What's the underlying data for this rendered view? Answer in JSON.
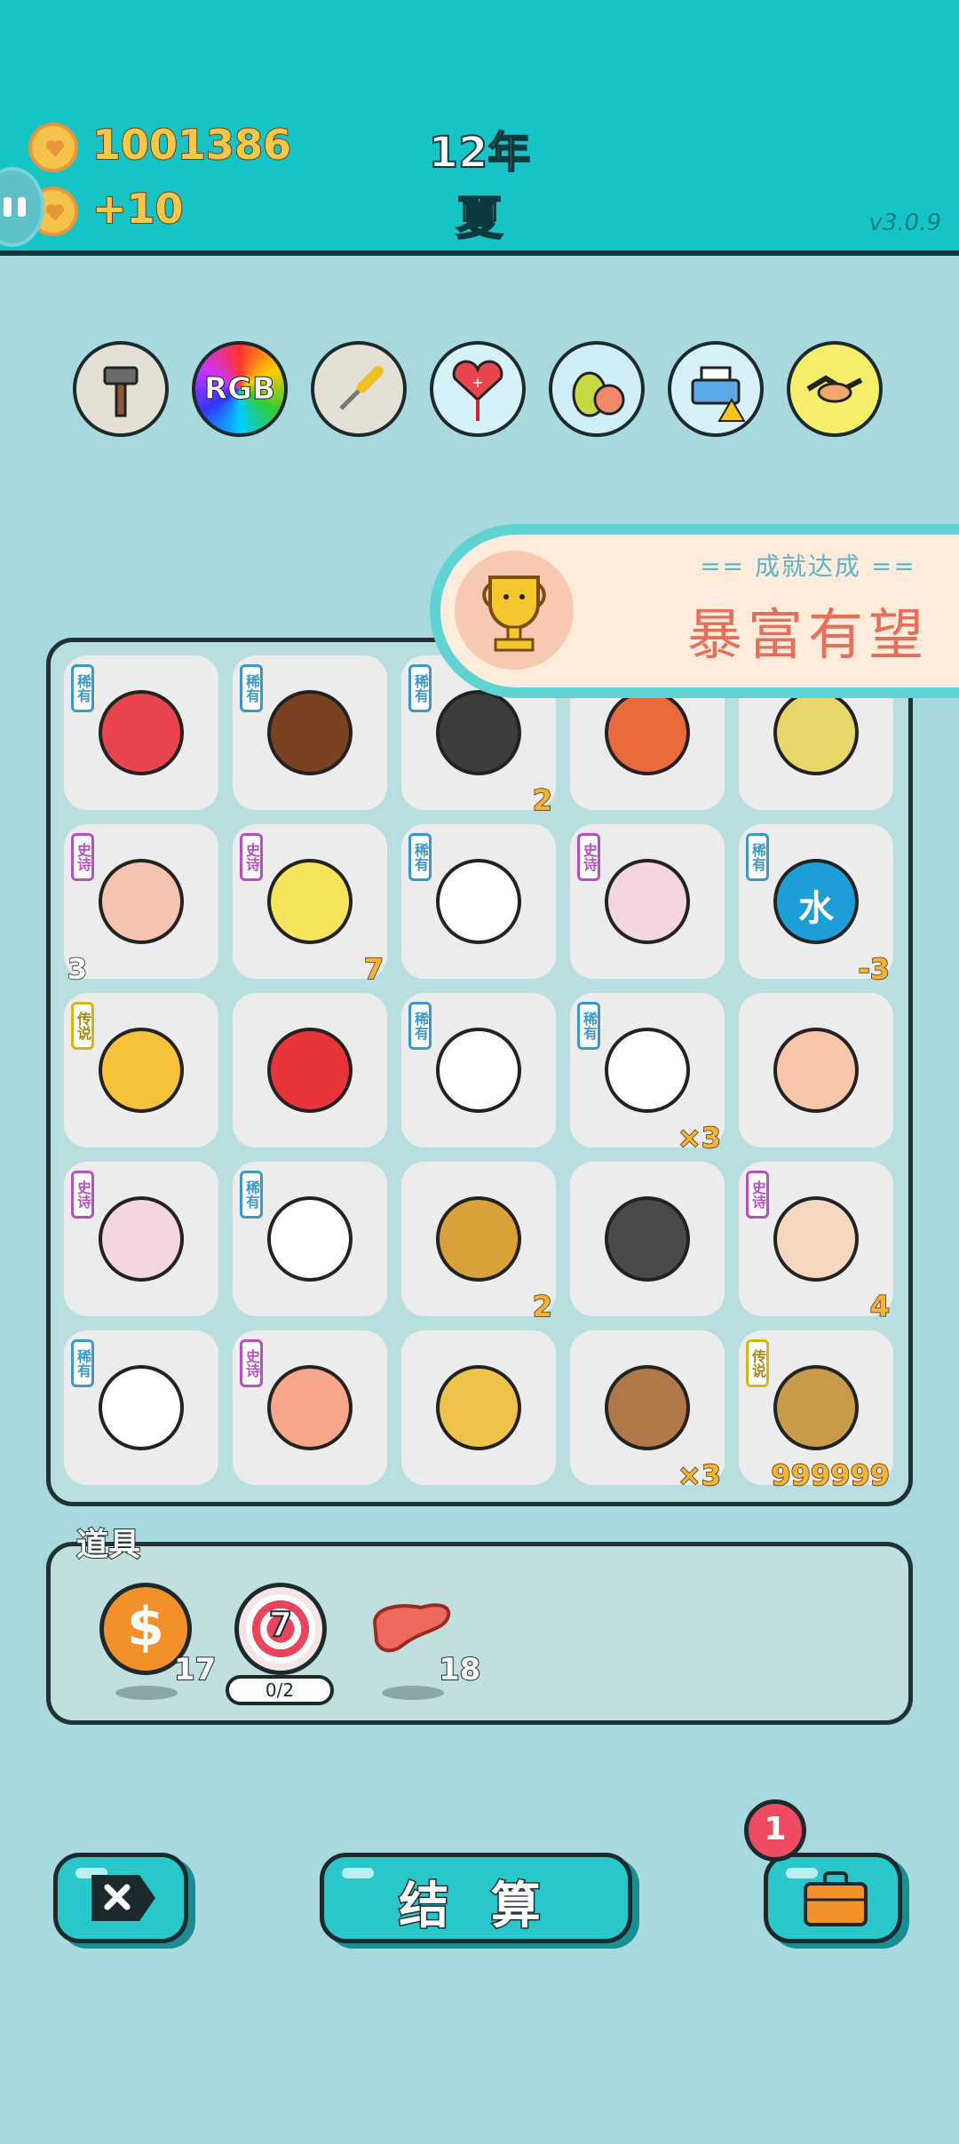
{
  "status": {
    "coins": "1001386",
    "income": "+10",
    "year": "12年",
    "season": "夏",
    "version": "v3.0.9"
  },
  "tools": [
    {
      "name": "hammer-icon"
    },
    {
      "name": "rgb-icon",
      "label": "RGB"
    },
    {
      "name": "screwdriver-icon"
    },
    {
      "name": "heart-fan-icon"
    },
    {
      "name": "fruit-icon"
    },
    {
      "name": "printer-icon"
    },
    {
      "name": "handshake-icon"
    }
  ],
  "achievement": {
    "title": "== 成就达成 ==",
    "name": "暴富有望"
  },
  "tags": {
    "rare": "稀有",
    "epic": "史诗",
    "legend": "传说"
  },
  "board": [
    [
      {
        "icon": "watermelon-icon",
        "tag": "rare",
        "count": ""
      },
      {
        "icon": "pointing-finger-icon",
        "tag": "rare",
        "count": ""
      },
      {
        "icon": "hat-man-icon",
        "tag": "rare",
        "count": "2"
      },
      {
        "icon": "chef-icon",
        "tag": "",
        "count": ""
      },
      {
        "icon": "straw-icon",
        "tag": "",
        "count": ""
      }
    ],
    [
      {
        "icon": "grandpa-icon",
        "tag": "epic",
        "count": "3",
        "countLeft": true
      },
      {
        "icon": "chick-face-icon",
        "tag": "epic",
        "count": "7"
      },
      {
        "icon": "rabbit-icon",
        "tag": "rare",
        "count": ""
      },
      {
        "icon": "rabbit-house-icon",
        "tag": "epic",
        "count": ""
      },
      {
        "icon": "water-element-icon",
        "tag": "rare",
        "count": "-3",
        "label": "水"
      }
    ],
    [
      {
        "icon": "hand-icon",
        "tag": "legend",
        "count": ""
      },
      {
        "icon": "drink-cup-icon",
        "tag": "",
        "count": ""
      },
      {
        "icon": "rabbit-icon",
        "tag": "rare",
        "count": ""
      },
      {
        "icon": "rabbit-icon",
        "tag": "rare",
        "count": "×3"
      },
      {
        "icon": "man-face-icon",
        "tag": "",
        "count": ""
      }
    ],
    [
      {
        "icon": "rabbit-house-icon",
        "tag": "epic",
        "count": ""
      },
      {
        "icon": "rabbit-icon",
        "tag": "rare",
        "count": ""
      },
      {
        "icon": "soup-bowl-icon",
        "tag": "",
        "count": "2"
      },
      {
        "icon": "trash-bag-icon",
        "tag": "",
        "count": ""
      },
      {
        "icon": "king-icon",
        "tag": "epic",
        "count": "4"
      }
    ],
    [
      {
        "icon": "rabbit-icon",
        "tag": "rare",
        "count": ""
      },
      {
        "icon": "peach-icon",
        "tag": "epic",
        "count": ""
      },
      {
        "icon": "cat-icon",
        "tag": "",
        "count": ""
      },
      {
        "icon": "monkey-icon",
        "tag": "",
        "count": "×3"
      },
      {
        "icon": "bubble-tea-icon",
        "tag": "legend",
        "count": "999999"
      }
    ]
  ],
  "items": {
    "title": "道具",
    "coin_count": "17",
    "target_number": "7",
    "target_progress": "0/2",
    "liver_count": "18"
  },
  "actions": {
    "settle_label": "结 算",
    "bag_badge": "1"
  }
}
